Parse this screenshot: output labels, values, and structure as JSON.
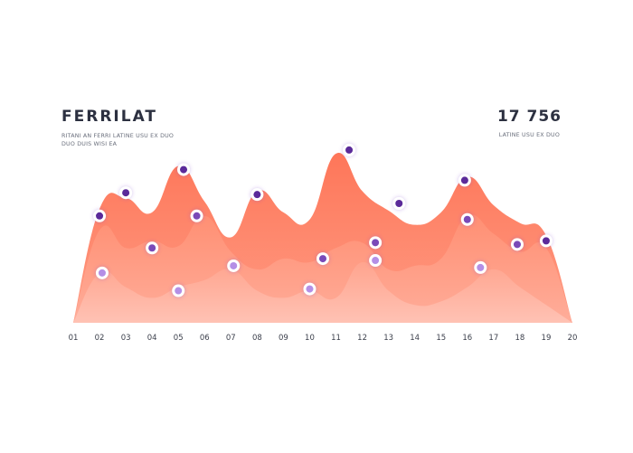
{
  "header": {
    "title": "FERRILAT",
    "subtitle": "RITANI AN FERRI LATINE USU EX DUO DUO DUIS WISI EA",
    "kpi_value": "17 756",
    "kpi_label": "LATINE USU EX DUO"
  },
  "colors": {
    "layer_back": "#fe8668",
    "layer_mid": "#ff9c84",
    "layer_front": "#ffb9a9",
    "marker_dark": "#5b2a9a",
    "marker_light": "#b48fe6"
  },
  "chart_data": {
    "type": "area",
    "x": [
      "01",
      "02",
      "03",
      "04",
      "05",
      "06",
      "07",
      "08",
      "09",
      "10",
      "11",
      "12",
      "13",
      "14",
      "15",
      "16",
      "17",
      "18",
      "19",
      "20"
    ],
    "ylim": [
      0,
      100
    ],
    "grid": false,
    "legend": "none",
    "series": [
      {
        "values": [
          0,
          64,
          70,
          62,
          88,
          68,
          48,
          74,
          62,
          58,
          95,
          74,
          63,
          55,
          62,
          82,
          66,
          56,
          49,
          0
        ],
        "markers": [
          {
            "x": 2.0,
            "y": 60
          },
          {
            "x": 3.0,
            "y": 73
          },
          {
            "x": 5.2,
            "y": 86
          },
          {
            "x": 8.0,
            "y": 72
          },
          {
            "x": 11.5,
            "y": 97
          },
          {
            "x": 13.4,
            "y": 67
          },
          {
            "x": 15.9,
            "y": 80
          },
          {
            "x": 19.0,
            "y": 46
          }
        ]
      },
      {
        "values": [
          0,
          52,
          42,
          46,
          43,
          60,
          40,
          30,
          36,
          34,
          42,
          45,
          30,
          32,
          36,
          60,
          50,
          40,
          42,
          0
        ],
        "markers": [
          {
            "x": 4.0,
            "y": 42
          },
          {
            "x": 5.7,
            "y": 60
          },
          {
            "x": 10.5,
            "y": 36
          },
          {
            "x": 12.5,
            "y": 45
          },
          {
            "x": 16.0,
            "y": 58
          },
          {
            "x": 17.9,
            "y": 44
          }
        ]
      },
      {
        "values": [
          0,
          28,
          20,
          14,
          20,
          24,
          30,
          18,
          14,
          18,
          14,
          34,
          18,
          10,
          12,
          20,
          30,
          20,
          10,
          0
        ],
        "markers": [
          {
            "x": 2.1,
            "y": 28
          },
          {
            "x": 5.0,
            "y": 18
          },
          {
            "x": 7.1,
            "y": 32
          },
          {
            "x": 10.0,
            "y": 19
          },
          {
            "x": 12.5,
            "y": 35
          },
          {
            "x": 16.5,
            "y": 31
          }
        ]
      }
    ]
  }
}
